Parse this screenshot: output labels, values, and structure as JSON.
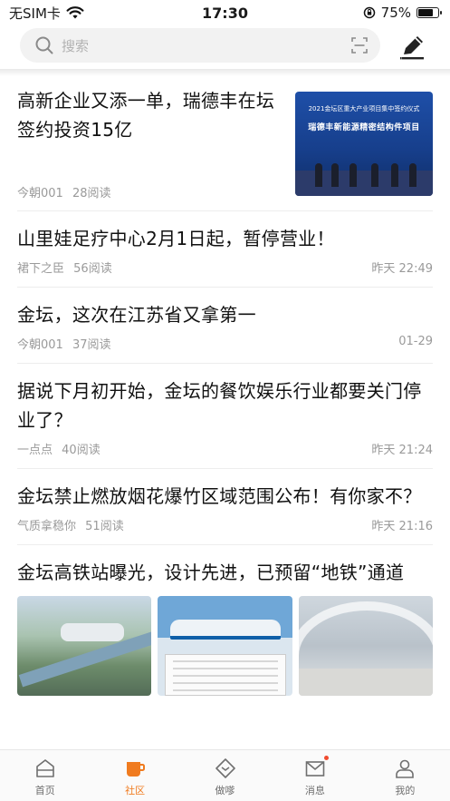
{
  "status_bar": {
    "carrier": "无SIM卡",
    "time": "17:30",
    "battery": "75%",
    "battery_level": 0.75
  },
  "search": {
    "placeholder": "搜索"
  },
  "icons": {
    "search": "search-icon",
    "scan": "scan-icon",
    "compose": "pen-icon"
  },
  "feed": [
    {
      "title": "高新企业又添一单，瑞德丰在坛签约投资15亿",
      "source": "今朝001",
      "reads": "28阅读",
      "time": "",
      "thumb_line1": "2021金坛区重大产业项目集中签约仪式",
      "thumb_line2": "瑞德丰新能源精密结构件项目"
    },
    {
      "title": "山里娃足疗中心2月1日起，暂停营业！",
      "source": "裙下之臣",
      "reads": "56阅读",
      "time": "昨天 22:49"
    },
    {
      "title": "金坛，这次在江苏省又拿第一",
      "source": "今朝001",
      "reads": "37阅读",
      "time": "01-29"
    },
    {
      "title": "据说下月初开始，金坛的餐饮娱乐行业都要关门停业了？",
      "source": "一点点",
      "reads": "40阅读",
      "time": "昨天 21:24"
    },
    {
      "title": "金坛禁止燃放烟花爆竹区域范围公布！有你家不？",
      "source": "气质拿稳你",
      "reads": "51阅读",
      "time": "昨天 21:16"
    },
    {
      "title": "金坛高铁站曝光，设计先进，已预留“地铁”通道"
    }
  ],
  "tabs": [
    {
      "label": "首页",
      "icon": "home-icon",
      "active": false
    },
    {
      "label": "社区",
      "icon": "cup-icon",
      "active": true
    },
    {
      "label": "做嗲",
      "icon": "diamond-icon",
      "active": false
    },
    {
      "label": "消息",
      "icon": "mail-icon",
      "active": false
    },
    {
      "label": "我的",
      "icon": "person-icon",
      "active": false
    }
  ],
  "colors": {
    "accent": "#f07b1f",
    "text": "#111111",
    "meta": "#9a9a9a"
  }
}
